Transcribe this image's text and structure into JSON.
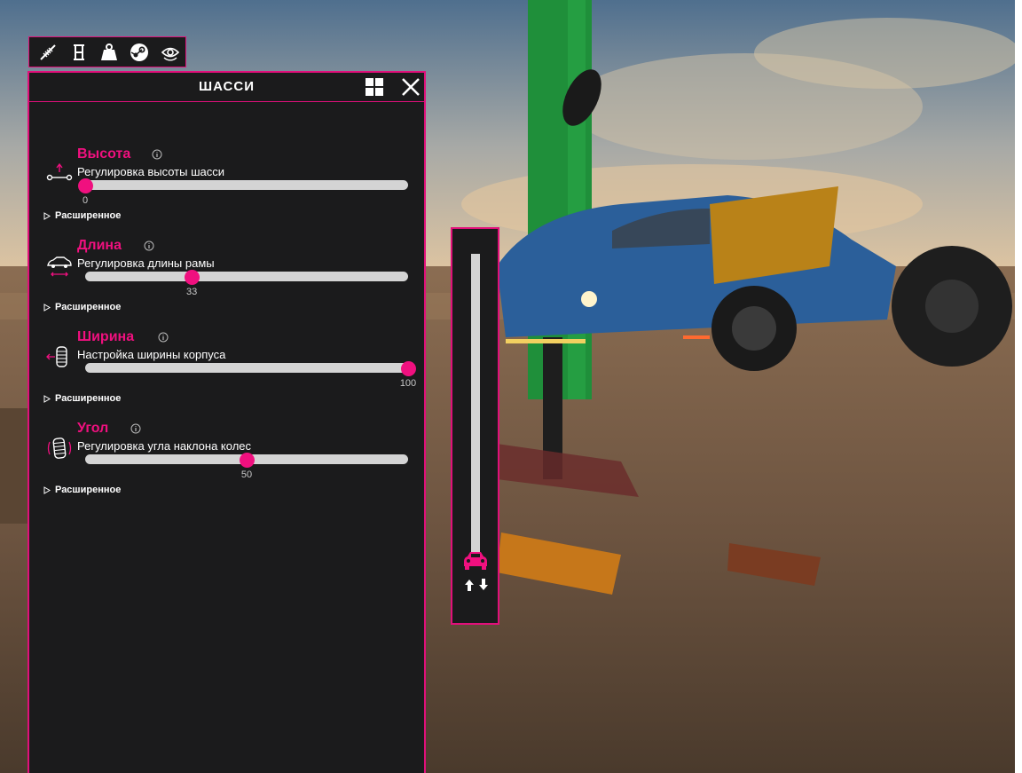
{
  "toolbar": {
    "items": [
      {
        "name": "suspension-icon"
      },
      {
        "name": "chassis-icon"
      },
      {
        "name": "weight-icon"
      },
      {
        "name": "steam-icon"
      },
      {
        "name": "view-icon"
      }
    ]
  },
  "panel": {
    "title": "ШАССИ",
    "sections": [
      {
        "title": "Высота",
        "desc": "Регулировка высоты шасси",
        "value": "0",
        "fraction": 0.0,
        "advanced": "Расширенное",
        "icon": "height-icon"
      },
      {
        "title": "Длина",
        "desc": "Регулировка длины рамы",
        "value": "33",
        "fraction": 0.33,
        "advanced": "Расширенное",
        "icon": "length-icon"
      },
      {
        "title": "Ширина",
        "desc": "Настройка ширины корпуса",
        "value": "100",
        "fraction": 1.0,
        "advanced": "Расширенное",
        "icon": "width-icon"
      },
      {
        "title": "Угол",
        "desc": "Регулировка угла наклона колес",
        "value": "50",
        "fraction": 0.5,
        "advanced": "Расширенное",
        "icon": "camber-icon"
      }
    ]
  },
  "colors": {
    "accent": "#f0107f",
    "panel_bg": "#1b1b1c",
    "track": "#d4d4d4"
  }
}
